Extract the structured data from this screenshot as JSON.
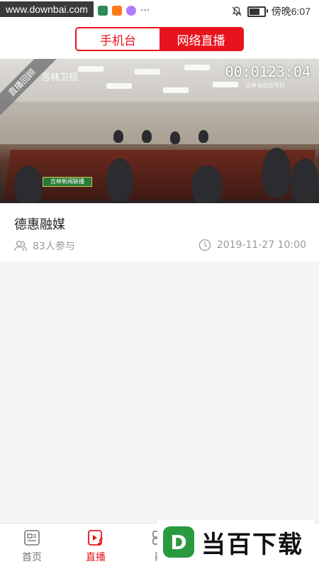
{
  "status_bar": {
    "watermark": "www.downbai.com",
    "time": "傍晚6:07",
    "more": "···"
  },
  "header": {
    "tabs": [
      {
        "label": "手机台",
        "active": false
      },
      {
        "label": "网络直播",
        "active": true
      }
    ]
  },
  "video": {
    "replay_label": "直播回顾",
    "channel": "吉林卫视",
    "timecode": "00:0123:04",
    "timecode_sub": "吉林电视台节目",
    "news_banner": "吉林新闻联播"
  },
  "card": {
    "title": "德惠融媒",
    "participants": "83人参与",
    "datetime": "2019-11-27 10:00"
  },
  "tabbar": {
    "tabs": [
      {
        "label": "首页",
        "icon": "news-icon",
        "active": false
      },
      {
        "label": "直播",
        "icon": "live-icon",
        "active": true
      },
      {
        "label": "融",
        "icon": "grid-icon",
        "active": false
      }
    ]
  },
  "ad": {
    "logo_text": "D",
    "text": "当百下载"
  },
  "colors": {
    "accent": "#e8141d",
    "muted": "#9a9a9a"
  }
}
